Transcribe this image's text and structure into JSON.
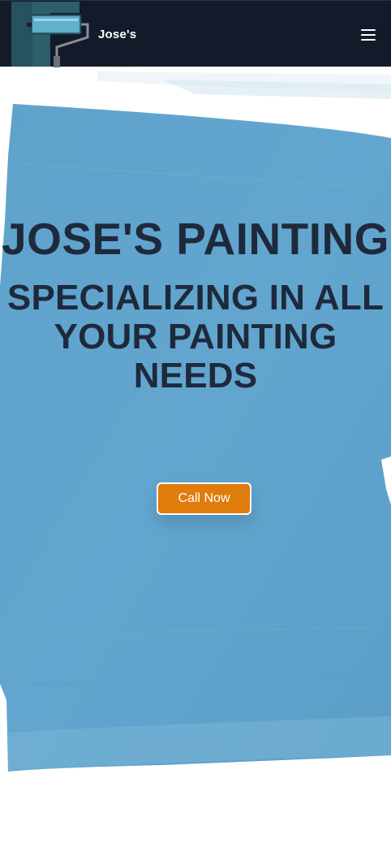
{
  "header": {
    "brand_name": "Jose's",
    "logo_icon": "paint-roller-icon",
    "menu_icon": "hamburger-menu-icon"
  },
  "hero": {
    "title": "JOSE'S PAINTING",
    "subtitle": "SPECIALIZING IN ALL YOUR PAINTING NEEDS",
    "cta_label": "Call Now"
  },
  "colors": {
    "header_bg": "#131a29",
    "paint_blue": "#5fa3cc",
    "text_dark": "#1e2a3c",
    "cta_orange": "#df7c0c"
  }
}
